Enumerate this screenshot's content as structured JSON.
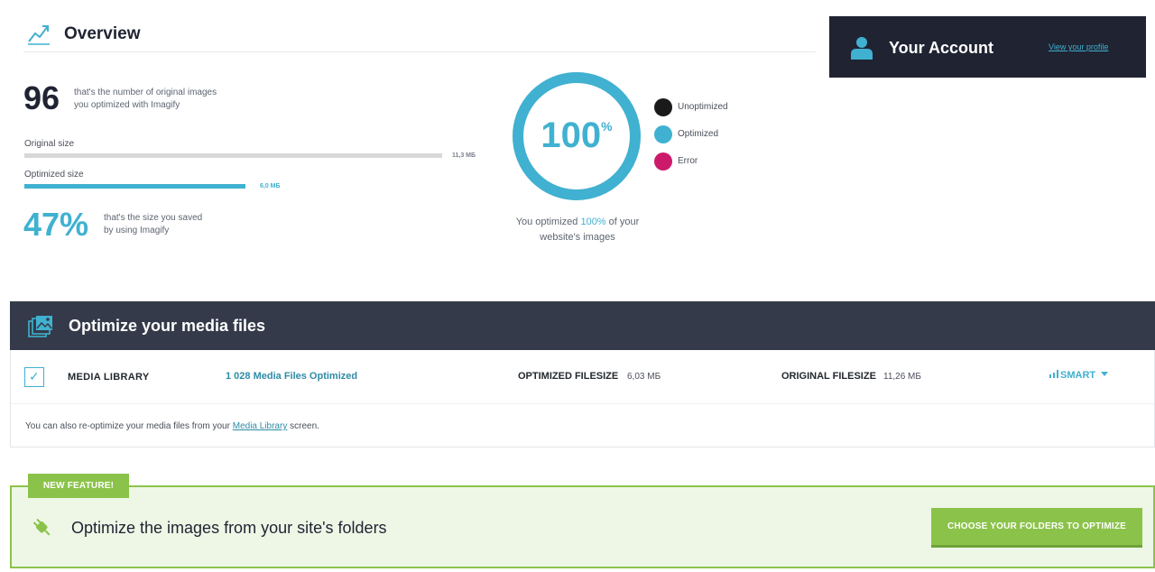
{
  "overview": {
    "title": "Overview",
    "icon": "chart-line-icon",
    "images_count": "96",
    "images_desc_line1": "that's the number of original images",
    "images_desc_line2": "you optimized with Imagify",
    "original_size_label": "Original size",
    "original_size_value": "11,3 МБ",
    "optimized_size_label": "Optimized size",
    "optimized_size_value": "6,0 МБ",
    "optimized_size_fraction": 0.53,
    "saved_percent": "47%",
    "saved_desc_line1": "that's the size you saved",
    "saved_desc_line2": "by using Imagify",
    "donut_value": "100",
    "donut_unit": "%",
    "donut_fraction": 1.0,
    "caption_prefix": "You optimized",
    "caption_highlight": "100%",
    "caption_suffix": "of your",
    "caption_line2": "website's images",
    "legend": [
      {
        "label": "Unoptimized",
        "color": "#1a1a1a"
      },
      {
        "label": "Optimized",
        "color": "#40b1d0"
      },
      {
        "label": "Error",
        "color": "#cc1a6a"
      }
    ]
  },
  "account": {
    "title": "Your Account",
    "icon": "user-icon",
    "profile_link": "View your profile"
  },
  "media": {
    "title": "Optimize your media files",
    "icon": "images-stack-icon",
    "row": {
      "label": "MEDIA LIBRARY",
      "count": "1 028 Media Files Optimized",
      "optimized_label": "OPTIMIZED FILESIZE",
      "optimized_value": "6,03 МБ",
      "original_label": "ORIGINAL FILESIZE",
      "original_value": "11,26 МБ",
      "level": "SMART"
    },
    "note_prefix": "You can also re-optimize your media files from your",
    "note_link": "Media Library",
    "note_suffix": "screen."
  },
  "feature": {
    "badge": "NEW FEATURE!",
    "title": "Optimize the images from your site's folders",
    "button": "CHOOSE YOUR FOLDERS TO OPTIMIZE",
    "icon": "plug-icon"
  },
  "colors": {
    "accent": "#40b1d0",
    "dark": "#1f2332",
    "header": "#343a49",
    "green": "#8bc34a"
  }
}
